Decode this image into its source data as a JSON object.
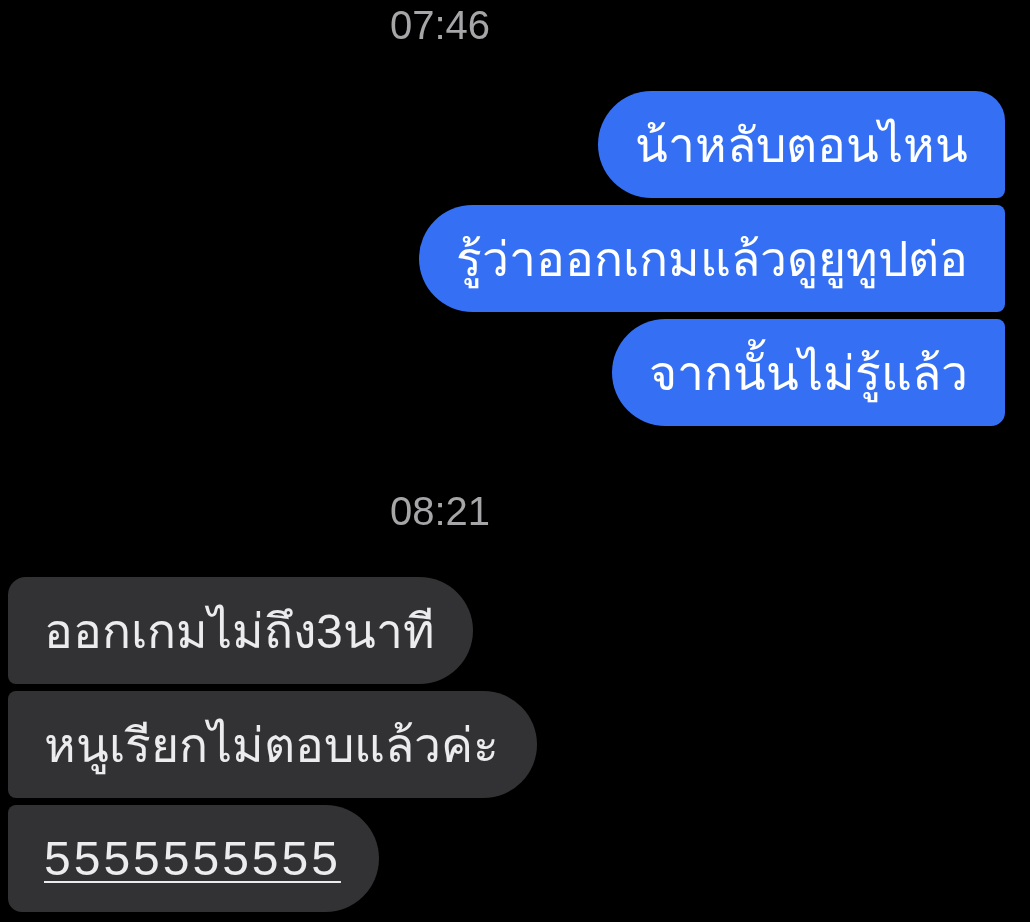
{
  "thread": [
    {
      "time": "07:46",
      "messages": [
        {
          "kind": "sent",
          "text": "น้าหลับตอนไหน",
          "link": false
        },
        {
          "kind": "sent",
          "text": "รู้ว่าออกเกมแล้วดูยูทูปต่อ",
          "link": false
        },
        {
          "kind": "sent",
          "text": "จากนั้นไม่รู้แล้ว",
          "link": false
        }
      ]
    },
    {
      "time": "08:21",
      "messages": [
        {
          "kind": "received",
          "text": "ออกเกมไม่ถึง3นาที",
          "link": false
        },
        {
          "kind": "received",
          "text": "หนูเรียกไม่ตอบแล้วค่ะ",
          "link": false
        },
        {
          "kind": "received",
          "text": "5555555555",
          "link": true
        }
      ]
    }
  ]
}
